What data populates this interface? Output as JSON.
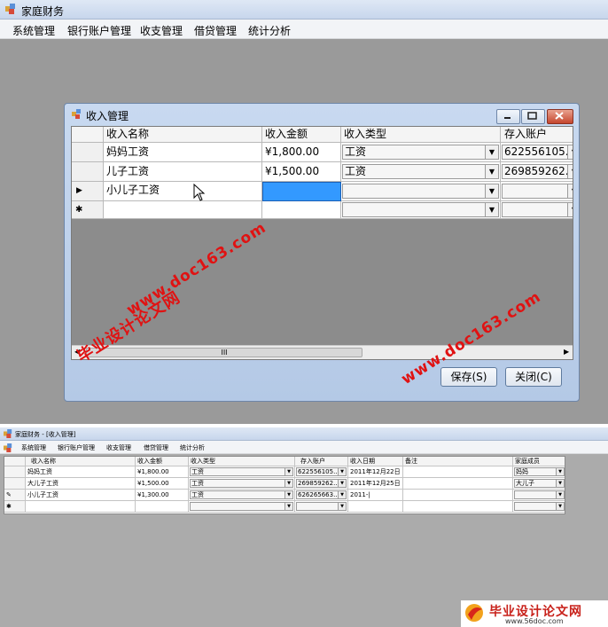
{
  "top": {
    "title": "家庭财务",
    "menu": [
      "系统管理",
      "银行账户管理",
      "收支管理",
      "借贷管理",
      "统计分析"
    ],
    "dialog": {
      "title": "收入管理",
      "columns": [
        "收入名称",
        "收入金额",
        "收入类型",
        "存入账户"
      ],
      "rows": [
        {
          "name": "妈妈工资",
          "amount": "¥1,800.00",
          "type": "工资",
          "account": "622556105..."
        },
        {
          "name": "儿子工资",
          "amount": "¥1,500.00",
          "type": "工资",
          "account": "269859262..."
        },
        {
          "name": "小儿子工资",
          "amount": "",
          "type": "",
          "account": ""
        },
        {
          "name": "",
          "amount": "",
          "type": "",
          "account": ""
        }
      ],
      "current_row_marker": "▶",
      "new_row_marker": "✱",
      "scroll_mark": "III",
      "save_label": "保存(S)",
      "close_label": "关闭(C)"
    }
  },
  "bottom": {
    "title": "家庭财务 - [收入管理]",
    "menu": [
      "系统管理",
      "银行账户管理",
      "收支管理",
      "借贷管理",
      "统计分析"
    ],
    "columns": [
      "收入名称",
      "收入金额",
      "收入类型",
      "存入账户",
      "收入日期",
      "备注",
      "家庭成员"
    ],
    "rows": [
      {
        "marker": "",
        "name": "妈妈工资",
        "amount": "¥1,800.00",
        "type": "工资",
        "account": "622556105...",
        "date": "2011年12月22日",
        "note": "",
        "member": "妈妈"
      },
      {
        "marker": "",
        "name": "大儿子工资",
        "amount": "¥1,500.00",
        "type": "工资",
        "account": "269859262...",
        "date": "2011年12月25日",
        "note": "",
        "member": "大儿子"
      },
      {
        "marker": "✎",
        "name": "小儿子工资",
        "amount": "¥1,300.00",
        "type": "工资",
        "account": "626265663...",
        "date": "2011-|",
        "note": "",
        "member": ""
      },
      {
        "marker": "✱",
        "name": "",
        "amount": "",
        "type": "",
        "account": "",
        "date": "",
        "note": "",
        "member": ""
      }
    ]
  },
  "watermarks": {
    "site_a": "www.doc163.com",
    "brand": "毕业设计论文网",
    "site_b": "www.doc163.com",
    "logo_text": "毕业设计论文网",
    "logo_url": "www.56doc.com"
  },
  "colors": {
    "accent": "#3399ff",
    "watermark": "#e01212",
    "mdi_background": "#9a9a9a"
  }
}
